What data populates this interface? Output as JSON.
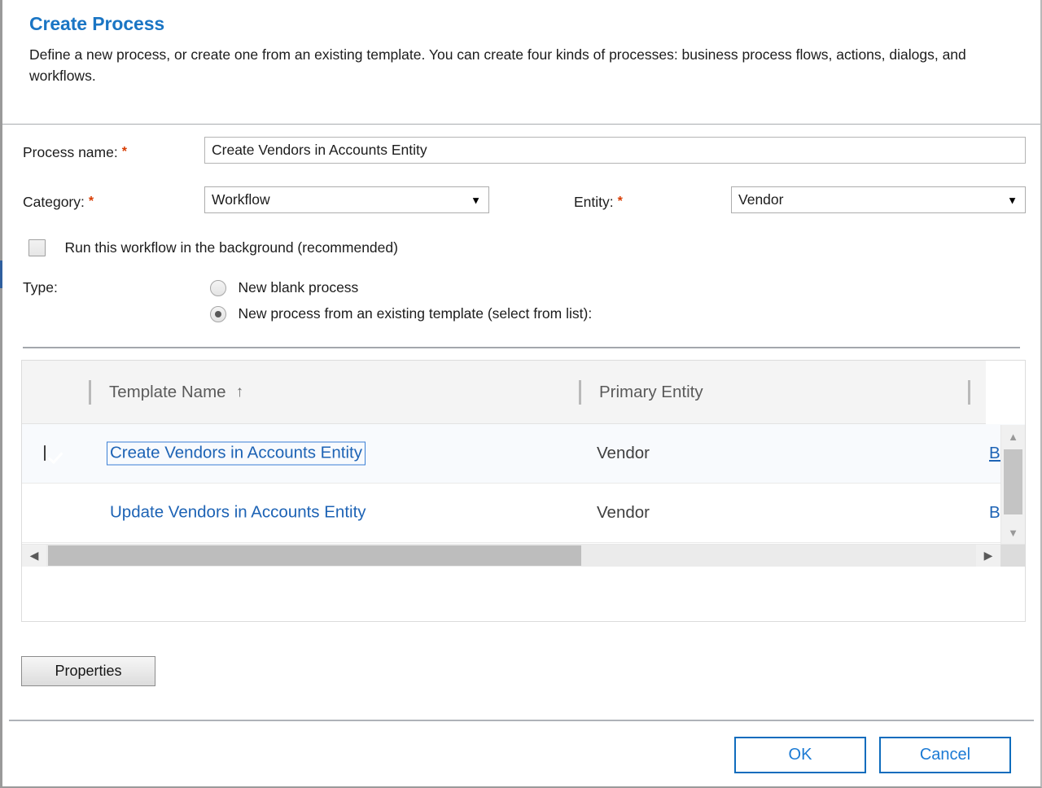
{
  "dialog": {
    "title": "Create Process",
    "description": "Define a new process, or create one from an existing template. You can create four kinds of processes: business process flows, actions, dialogs, and workflows."
  },
  "form": {
    "process_name": {
      "label": "Process name:",
      "required_marker": "*",
      "value": "Create Vendors in Accounts Entity",
      "placeholder": ""
    },
    "category": {
      "label": "Category:",
      "required_marker": "*",
      "value": "Workflow",
      "arrow": "▼"
    },
    "entity": {
      "label": "Entity:",
      "required_marker": "*",
      "value": "Vendor",
      "arrow": "▼"
    },
    "background_checkbox": {
      "label": "Run this workflow in the background (recommended)",
      "checked": false
    },
    "type": {
      "label": "Type:",
      "options": [
        {
          "label": "New blank process",
          "selected": false
        },
        {
          "label": "New process from an existing template (select from list):",
          "selected": true
        }
      ]
    }
  },
  "grid": {
    "columns": [
      {
        "label": "Template Name",
        "sort_indicator": "↑"
      },
      {
        "label": "Primary Entity",
        "sort_indicator": ""
      }
    ],
    "rows": [
      {
        "checked": true,
        "template_name": "Create Vendors in Accounts Entity",
        "primary_entity": "Vendor",
        "truncated": "Bi",
        "selected": true
      },
      {
        "checked": false,
        "template_name": "Update Vendors in Accounts Entity",
        "primary_entity": "Vendor",
        "truncated": "Bi",
        "selected": false
      }
    ],
    "scrollbar": {
      "up_arrow": "▲",
      "down_arrow": "▼",
      "left_arrow": "◀",
      "right_arrow": "▶"
    }
  },
  "buttons": {
    "properties": "Properties",
    "ok": "OK",
    "cancel": "Cancel"
  },
  "colors": {
    "title_blue": "#1a75c4",
    "link_blue": "#1d63b5",
    "required_red": "#d83b01",
    "button_border_blue": "#0f6cbd"
  }
}
